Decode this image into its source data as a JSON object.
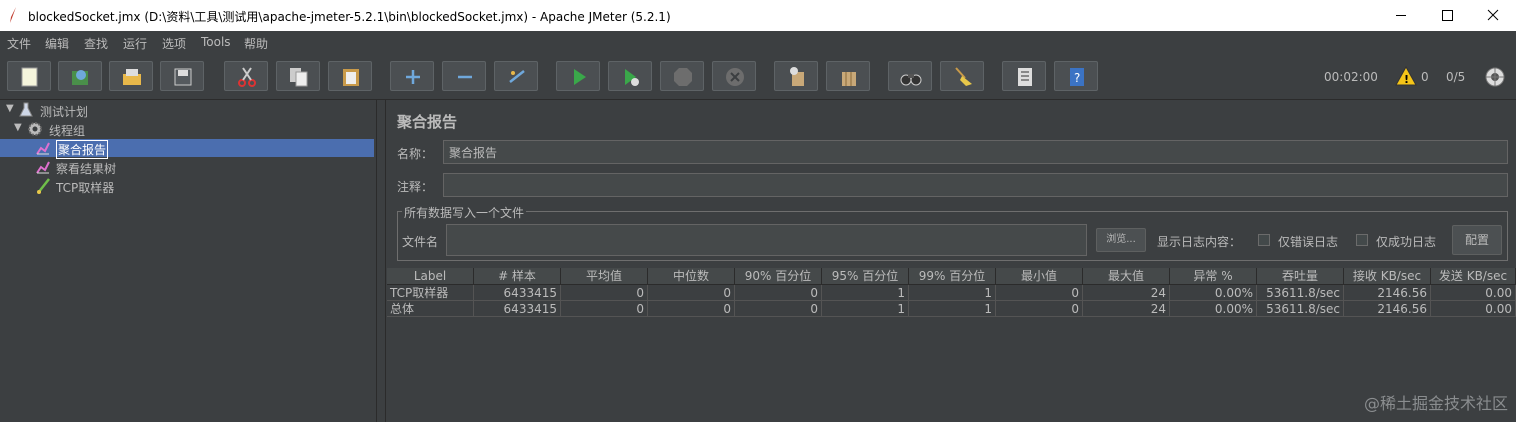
{
  "window": {
    "title": "blockedSocket.jmx (D:\\资料\\工具\\测试用\\apache-jmeter-5.2.1\\bin\\blockedSocket.jmx) - Apache JMeter (5.2.1)"
  },
  "menu": [
    "文件",
    "编辑",
    "查找",
    "运行",
    "选项",
    "Tools",
    "帮助"
  ],
  "toolbar": {
    "buttons": [
      "new-icon",
      "templates-icon",
      "open-icon",
      "save-icon",
      "cut-icon",
      "copy-icon",
      "paste-icon",
      "expand-icon",
      "collapse-icon",
      "toggle-icon",
      "start-icon",
      "start-no-pause-icon",
      "stop-icon",
      "shutdown-icon",
      "clear-icon",
      "clear-all-icon",
      "search-icon",
      "reset-search-icon",
      "function-helper-icon",
      "help-icon"
    ],
    "elapsed": "00:02:00",
    "warnings": "0",
    "threads": "0/5"
  },
  "tree": {
    "items": [
      {
        "label": "测试计划",
        "icon": "test-plan-icon"
      },
      {
        "label": "线程组",
        "icon": "thread-group-icon"
      },
      {
        "label": "聚合报告",
        "icon": "listener-icon",
        "selected": true
      },
      {
        "label": "察看结果树",
        "icon": "listener-icon"
      },
      {
        "label": "TCP取样器",
        "icon": "sampler-icon"
      }
    ]
  },
  "panel": {
    "title": "聚合报告",
    "name_label": "名称：",
    "name_value": "聚合报告",
    "comment_label": "注释：",
    "comment_value": "",
    "file_group_legend": "所有数据写入一个文件",
    "filename_label": "文件名",
    "filename_value": "",
    "browse_label": "浏览...",
    "log_content_label": "显示日志内容：",
    "errors_only_label": "仅错误日志",
    "success_only_label": "仅成功日志",
    "configure_label": "配置"
  },
  "table": {
    "headers": [
      "Label",
      "# 样本",
      "平均值",
      "中位数",
      "90% 百分位",
      "95% 百分位",
      "99% 百分位",
      "最小值",
      "最大值",
      "异常 %",
      "吞吐量",
      "接收 KB/sec",
      "发送 KB/sec"
    ],
    "rows": [
      [
        "TCP取样器",
        "6433415",
        "0",
        "0",
        "0",
        "1",
        "1",
        "0",
        "24",
        "0.00%",
        "53611.8/sec",
        "2146.56",
        "0.00"
      ],
      [
        "总体",
        "6433415",
        "0",
        "0",
        "0",
        "1",
        "1",
        "0",
        "24",
        "0.00%",
        "53611.8/sec",
        "2146.56",
        "0.00"
      ]
    ]
  },
  "watermark": "@稀土掘金技术社区"
}
